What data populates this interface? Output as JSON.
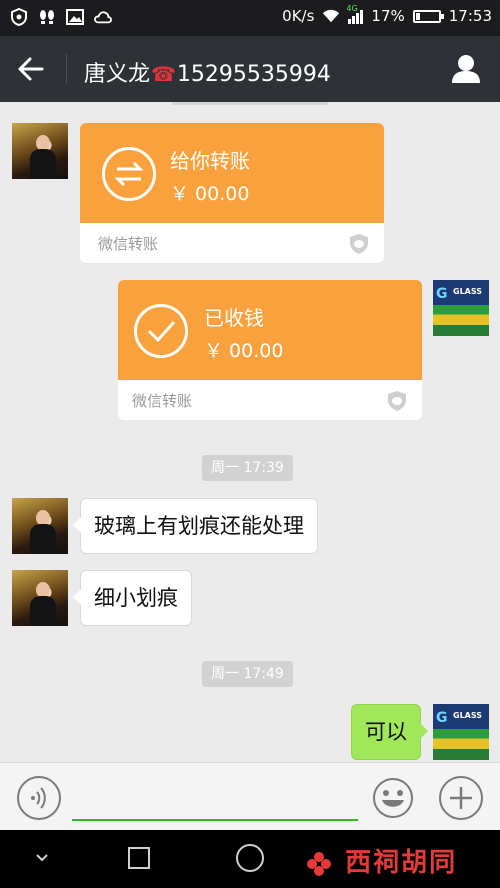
{
  "status_bar": {
    "speed": "0K/s",
    "network": "4G",
    "battery": "17%",
    "battery_level": 0.17,
    "time": "17:53"
  },
  "header": {
    "contact_name": "唐义龙",
    "phone_glyph": "☎",
    "phone_number": "15295535994"
  },
  "messages": {
    "transfer_received": {
      "title": "给你转账",
      "amount": "￥ 00.00",
      "footer": "微信转账"
    },
    "transfer_accepted": {
      "title": "已收钱",
      "amount": "￥ 00.00",
      "footer": "微信转账"
    },
    "timestamp_1": "周一 17:39",
    "text_1": "玻璃上有划痕还能处理",
    "text_2": "细小划痕",
    "timestamp_2": "周一 17:49",
    "reply": "可以"
  },
  "sender_avatar": {
    "badge_letter": "G",
    "badge_text": "GLASS"
  },
  "input_bar": {
    "message_value": ""
  },
  "watermark": {
    "text": "西祠胡同"
  },
  "colors": {
    "transfer_orange": "#f9a13c",
    "outgoing_green": "#a0e759",
    "titlebar": "#2e3135",
    "chat_bg": "#ebebeb"
  }
}
